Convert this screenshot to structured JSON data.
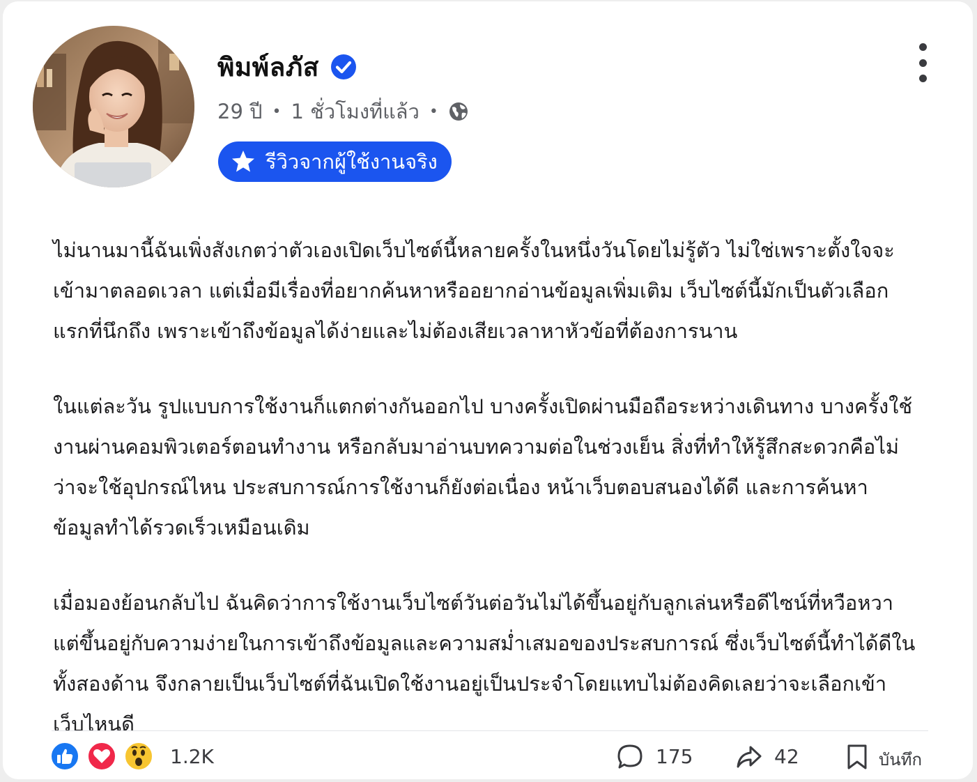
{
  "post": {
    "author_name": "พิมพ์ลภัส",
    "meta": {
      "age": "29 ปี",
      "time": "1 ชั่วโมงที่แล้ว",
      "separator": "•",
      "visibility_icon": "globe-icon"
    },
    "badge_label": "รีวิวจากผู้ใช้งานจริง",
    "paragraphs": [
      "ไม่นานมานี้ฉันเพิ่งสังเกตว่าตัวเองเปิดเว็บไซต์นี้หลายครั้งในหนึ่งวันโดยไม่รู้ตัว ไม่ใช่เพราะตั้งใจจะเข้ามาตลอดเวลา แต่เมื่อมีเรื่องที่อยากค้นหาหรืออยากอ่านข้อมูลเพิ่มเติม เว็บไซต์นี้มักเป็นตัวเลือกแรกที่นึกถึง เพราะเข้าถึงข้อมูลได้ง่ายและไม่ต้องเสียเวลาหาหัวข้อที่ต้องการนาน",
      "ในแต่ละวัน รูปแบบการใช้งานก็แตกต่างกันออกไป บางครั้งเปิดผ่านมือถือระหว่างเดินทาง บางครั้งใช้งานผ่านคอมพิวเตอร์ตอนทำงาน หรือกลับมาอ่านบทความต่อในช่วงเย็น สิ่งที่ทำให้รู้สึกสะดวกคือไม่ว่าจะใช้อุปกรณ์ไหน ประสบการณ์การใช้งานก็ยังต่อเนื่อง หน้าเว็บตอบสนองได้ดี และการค้นหาข้อมูลทำได้รวดเร็วเหมือนเดิม",
      "เมื่อมองย้อนกลับไป ฉันคิดว่าการใช้งานเว็บไซต์วันต่อวันไม่ได้ขึ้นอยู่กับลูกเล่นหรือดีไซน์ที่หวือหวา แต่ขึ้นอยู่กับความง่ายในการเข้าถึงข้อมูลและความสม่ำเสมอของประสบการณ์ ซึ่งเว็บไซต์นี้ทำได้ดีในทั้งสองด้าน จึงกลายเป็นเว็บไซต์ที่ฉันเปิดใช้งานอยู่เป็นประจำโดยแทบไม่ต้องคิดเลยว่าจะเลือกเข้าเว็บไหนดี"
    ]
  },
  "footer": {
    "reactions": [
      "like-icon",
      "love-icon",
      "wow-icon"
    ],
    "reaction_count": "1.2K",
    "comment_count": "175",
    "share_count": "42",
    "save_label": "บันทึก"
  },
  "colors": {
    "accent": "#1b55ef",
    "verified": "#1b55ef",
    "like": "#1877f2",
    "love": "#f0284a",
    "wow": "#f7c531"
  }
}
